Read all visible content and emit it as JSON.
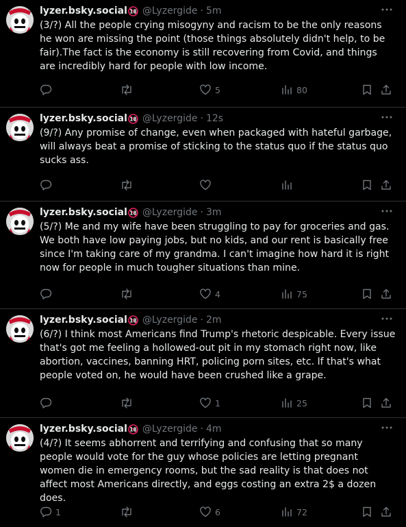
{
  "theme": {
    "background": "#000000",
    "text": "#e7e9ea",
    "muted": "#71767b",
    "divider": "#2f3336",
    "badge_red": "#e0245e"
  },
  "icons": {
    "reply": "speech-bubble-icon",
    "repost": "repost-arrows-icon",
    "like": "heart-icon",
    "views": "bar-chart-icon",
    "bookmark": "bookmark-icon",
    "share": "share-upload-icon",
    "more": "more-dots-icon",
    "badge": "18-plus-badge-icon"
  },
  "posts": [
    {
      "display_name": "lyzer.bsky.social",
      "handle": "@Lyzergide",
      "separator": "·",
      "time": "5m",
      "text": "(3/?) All the people crying misogyny and racism to be the only reasons he won are missing the point (those things absolutely didn't help, to be fair).The fact is the economy is still recovering from Covid, and things are incredibly hard for people with low income.",
      "replies": "",
      "reposts": "",
      "likes": "5",
      "views": "80"
    },
    {
      "display_name": "lyzer.bsky.social",
      "handle": "@Lyzergide",
      "separator": "·",
      "time": "12s",
      "text": "(9/?) Any promise of change, even when packaged with hateful garbage, will always beat a promise of sticking to the status quo if the status quo sucks ass.",
      "replies": "",
      "reposts": "",
      "likes": "",
      "views": ""
    },
    {
      "display_name": "lyzer.bsky.social",
      "handle": "@Lyzergide",
      "separator": "·",
      "time": "3m",
      "text": "(5/?) Me and my wife have been struggling to pay for groceries and gas. We both have low paying jobs, but no kids, and our rent is basically free since I'm taking care of my grandma. I can't imagine how hard it is right now for people in much tougher situations than mine.",
      "replies": "",
      "reposts": "",
      "likes": "4",
      "views": "75"
    },
    {
      "display_name": "lyzer.bsky.social",
      "handle": "@Lyzergide",
      "separator": "·",
      "time": "2m",
      "text": "(6/?) I think most Americans find Trump's rhetoric despicable. Every issue that's got me feeling a hollowed-out pit in my stomach right now, like abortion, vaccines, banning HRT, policing porn sites, etc. If that's what people voted on, he would have been crushed like a grape.",
      "replies": "",
      "reposts": "",
      "likes": "1",
      "views": "25"
    },
    {
      "display_name": "lyzer.bsky.social",
      "handle": "@Lyzergide",
      "separator": "·",
      "time": "4m",
      "text": "(4/?) It seems abhorrent and terrifying and confusing that so many people would vote for the guy whose policies are letting pregnant women die in emergency rooms, but the sad reality is that does not affect most Americans directly, and eggs costing an extra 2$ a dozen does.",
      "replies": "1",
      "reposts": "",
      "likes": "6",
      "views": "72"
    }
  ]
}
